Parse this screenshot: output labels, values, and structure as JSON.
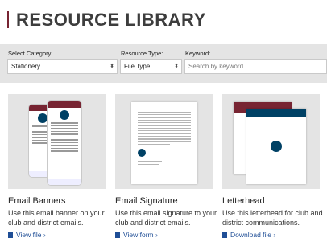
{
  "header": {
    "title": "RESOURCE LIBRARY"
  },
  "filters": {
    "category": {
      "label": "Select Category:",
      "value": "Stationery"
    },
    "type": {
      "label": "Resource Type:",
      "value": "File Type"
    },
    "keyword": {
      "label": "Keyword:",
      "placeholder": "Search by keyword"
    }
  },
  "cards": [
    {
      "title": "Email Banners",
      "description": "Use this email banner on your club and district emails.",
      "link": "View file ›"
    },
    {
      "title": "Email Signature",
      "description": "Use this email signature to your club and district emails.",
      "link": "View form ›"
    },
    {
      "title": "Letterhead",
      "description": "Use this letterhead for club and district communications.",
      "link": "Download file ›"
    }
  ],
  "colors": {
    "brand_maroon": "#772432",
    "brand_blue": "#004165",
    "link": "#1f4e96"
  }
}
